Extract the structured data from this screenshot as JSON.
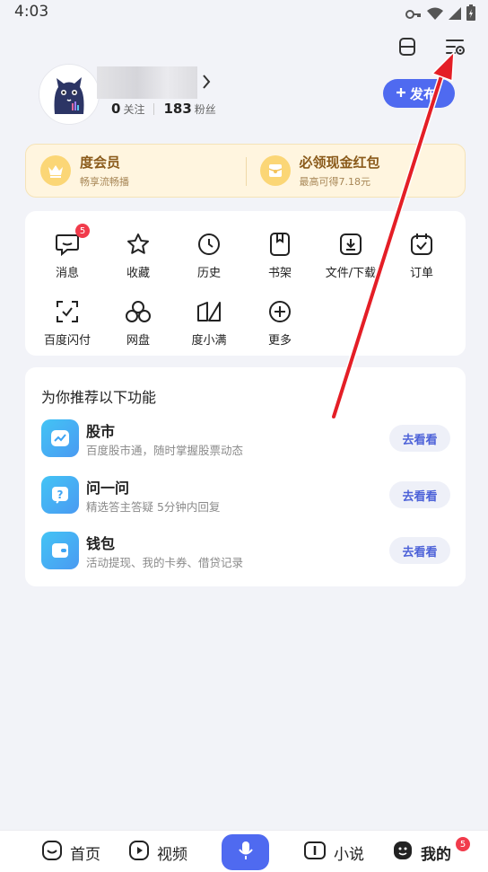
{
  "status_bar": {
    "time": "4:03",
    "icons": [
      "key-icon",
      "wifi-icon",
      "signal-icon",
      "battery-charging-icon"
    ]
  },
  "top_actions": {
    "icons": [
      "scan-icon",
      "settings-icon"
    ]
  },
  "profile": {
    "following_count": "0",
    "following_label": "关注",
    "followers_count": "183",
    "followers_label": "粉丝",
    "publish_label": "发布"
  },
  "vip": {
    "left": {
      "title": "度会员",
      "subtitle": "畅享流畅播"
    },
    "right": {
      "title": "必领现金红包",
      "subtitle": "最高可得7.18元"
    }
  },
  "grid": {
    "items": [
      {
        "label": "消息",
        "icon": "message-icon",
        "badge": "5"
      },
      {
        "label": "收藏",
        "icon": "star-icon"
      },
      {
        "label": "历史",
        "icon": "clock-icon"
      },
      {
        "label": "书架",
        "icon": "bookmark-icon"
      },
      {
        "label": "文件/下载",
        "icon": "download-icon"
      },
      {
        "label": "订单",
        "icon": "order-icon"
      },
      {
        "label": "百度闪付",
        "icon": "scan-pay-icon"
      },
      {
        "label": "网盘",
        "icon": "cloud-icon"
      },
      {
        "label": "度小满",
        "icon": "dxm-icon"
      },
      {
        "label": "更多",
        "icon": "plus-circle-icon"
      }
    ]
  },
  "recommend": {
    "title": "为你推荐以下功能",
    "items": [
      {
        "title": "股市",
        "subtitle": "百度股市通，随时掌握股票动态",
        "button": "去看看",
        "icon": "stock-icon"
      },
      {
        "title": "问一问",
        "subtitle": "精选答主答疑 5分钟内回复",
        "button": "去看看",
        "icon": "question-icon"
      },
      {
        "title": "钱包",
        "subtitle": "活动提现、我的卡券、借贷记录",
        "button": "去看看",
        "icon": "wallet-icon"
      }
    ]
  },
  "tabbar": {
    "home": "首页",
    "video": "视频",
    "novel": "小说",
    "mine": "我的",
    "mine_badge": "5"
  }
}
